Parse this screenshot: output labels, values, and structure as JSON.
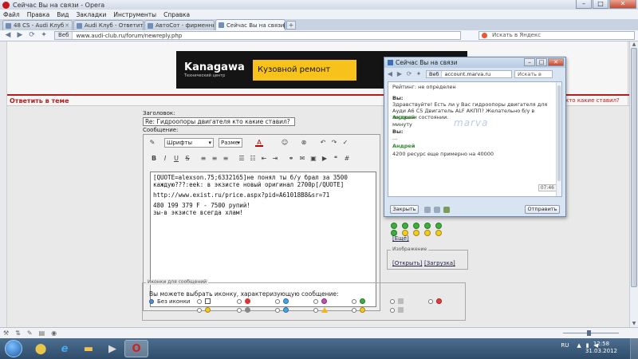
{
  "window": {
    "title": "Сейчас Вы на связи - Opera",
    "controls": {
      "minimize": "–",
      "maximize": "□",
      "close": "✕"
    }
  },
  "menu": [
    "Файл",
    "Правка",
    "Вид",
    "Закладки",
    "Инструменты",
    "Справка"
  ],
  "tabs": [
    {
      "label": "48 CS - Audi Клуб",
      "active": false
    },
    {
      "label": "Audi Клуб - Ответить...",
      "active": false
    },
    {
      "label": "АвтоСот - фирменны...",
      "active": false
    },
    {
      "label": "Сейчас Вы на связи",
      "active": true
    }
  ],
  "nav": {
    "back_icon": "back-arrow-icon",
    "forward_icon": "forward-arrow-icon",
    "reload_icon": "reload-icon",
    "badge": "Веб",
    "url": "www.audi-club.ru/forum/newreply.php",
    "search_placeholder": "Искать в Яндекс"
  },
  "page": {
    "banner": {
      "brand": "Kanagawa",
      "brand_sub": "Технический центр",
      "ad_text": "Кузовной ремонт"
    },
    "reply_heading": "Ответить в теме",
    "reply_heading_right": "кто какие ставил?",
    "subject_label": "Заголовок:",
    "subject_value": "Re: Гидроопоры двигателя кто какие ставил?",
    "message_label": "Сообщение:",
    "toolbar": {
      "font_select": "Шрифты",
      "size_select": "Разме",
      "color_label": "A"
    },
    "message_lines": [
      "[QUOTE=alexson.75;6332165]не понял ты б/у брал за 3500 каждую???:eek: в экзисте новый оригинал 2700р[/QUOTE]",
      "http://www.exist.ru/price.aspx?pid=A61018B8&sr=71",
      "480 199 379 F - 7500 рупий!\nзы-в экзисте всегда хлам!"
    ],
    "smilies_more": "[Ещё]",
    "attachments": {
      "legend": "Изображение",
      "open_link": "[Открыть]",
      "upload_link": "[Загрузка]"
    },
    "post_icons": {
      "legend": "Иконки для сообщений",
      "question": "Вы можете выбрать иконку, характеризующую сообщение:",
      "no_icon_label": "Без иконки"
    }
  },
  "status": {
    "icons": [
      "tools-icon",
      "transfer-icon",
      "notes-icon",
      "panel-icon",
      "view-icon"
    ]
  },
  "chat": {
    "title": "Сейчас Вы на связи",
    "badge": "Веб",
    "url": "account.marva.ru",
    "search_placeholder": "Искать в",
    "rating_line": "Рейтинг: не определен",
    "messages": [
      {
        "author": "Вы:",
        "text": "Здравствуйте! Есть ли у Вас гидроопоры двигателя для Ауди А6 С5 Двигатель ALF АКПП? Желательно б/у в хорошем состоянии."
      },
      {
        "author": "Андрей",
        "text": "минуту"
      },
      {
        "author": "Вы:",
        "text": "..."
      },
      {
        "author": "Андрей",
        "text": "4200 ресурс еще примерно на 40000"
      }
    ],
    "watermark": "marva",
    "time": "07:46",
    "close_button": "Закрыть",
    "send_button": "Отправить"
  },
  "taskbar": {
    "language": "RU",
    "time": "12:58",
    "date": "31.03.2012"
  }
}
